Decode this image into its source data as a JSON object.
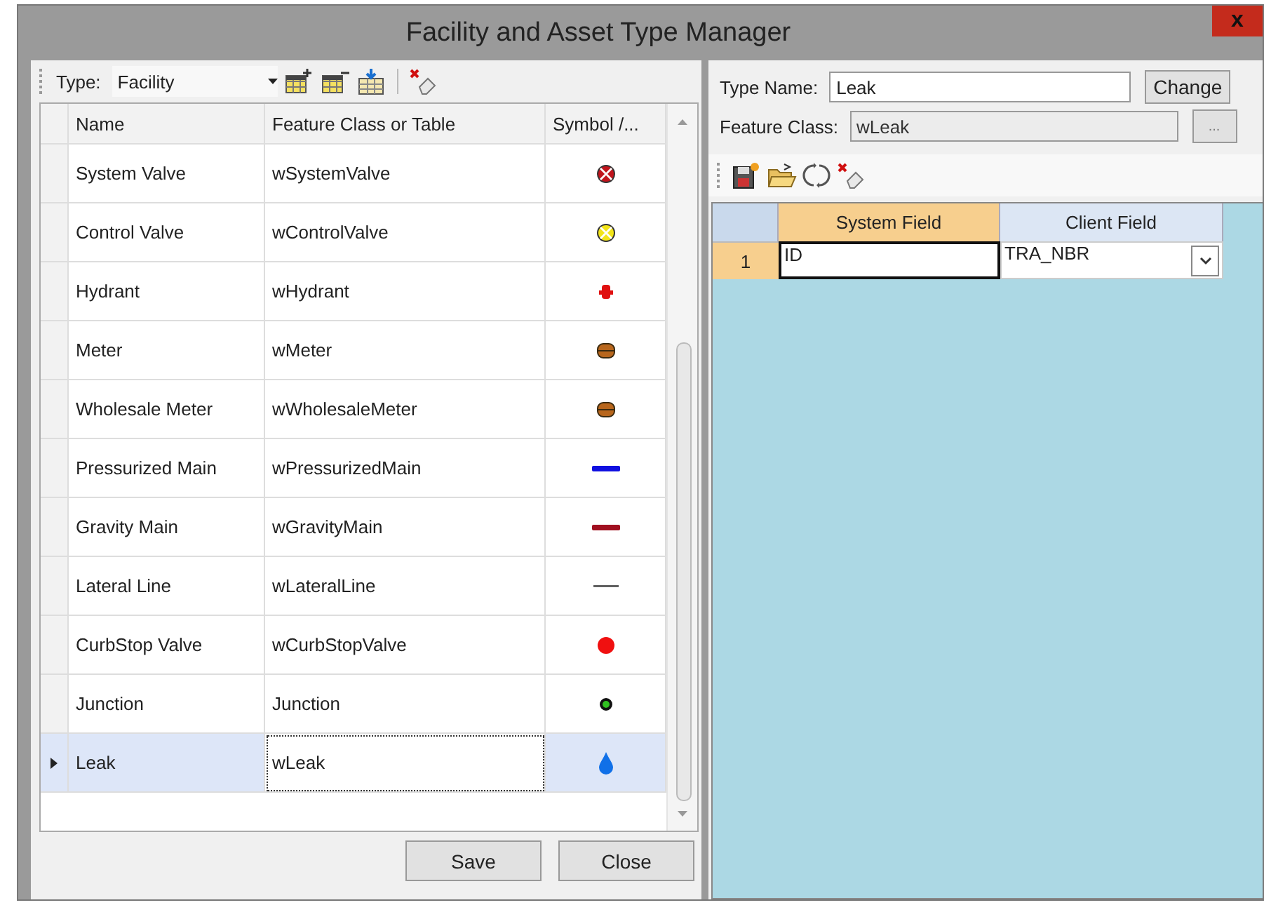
{
  "window": {
    "title": "Facility and Asset Type Manager",
    "close_label": "x"
  },
  "type_list": {
    "type_label": "Type:",
    "type_value": "Facility",
    "columns": [
      "Name",
      "Feature Class or Table",
      "Symbol /..."
    ],
    "rows": [
      {
        "name": "System Valve",
        "feature_class": "wSystemValve",
        "symbol": {
          "kind": "valve",
          "color": "#c0141c"
        },
        "selected": false
      },
      {
        "name": "Control Valve",
        "feature_class": "wControlValve",
        "symbol": {
          "kind": "valve",
          "color": "#f2e418"
        },
        "selected": false
      },
      {
        "name": "Hydrant",
        "feature_class": "wHydrant",
        "symbol": {
          "kind": "hydrant",
          "color": "#e01010"
        },
        "selected": false
      },
      {
        "name": "Meter",
        "feature_class": "wMeter",
        "symbol": {
          "kind": "meter",
          "color": "#b8661c"
        },
        "selected": false
      },
      {
        "name": "Wholesale Meter",
        "feature_class": "wWholesaleMeter",
        "symbol": {
          "kind": "meter",
          "color": "#b8661c"
        },
        "selected": false
      },
      {
        "name": "Pressurized Main",
        "feature_class": "wPressurizedMain",
        "symbol": {
          "kind": "line",
          "color": "#1010e0"
        },
        "selected": false
      },
      {
        "name": "Gravity Main",
        "feature_class": "wGravityMain",
        "symbol": {
          "kind": "line",
          "color": "#a01020"
        },
        "selected": false
      },
      {
        "name": "Lateral Line",
        "feature_class": "wLateralLine",
        "symbol": {
          "kind": "thin-line",
          "color": "#606060"
        },
        "selected": false
      },
      {
        "name": "CurbStop Valve",
        "feature_class": "wCurbStopValve",
        "symbol": {
          "kind": "dot",
          "color": "#f01010"
        },
        "selected": false
      },
      {
        "name": "Junction",
        "feature_class": "Junction",
        "symbol": {
          "kind": "ring-dot",
          "color": "#30c020"
        },
        "selected": false
      },
      {
        "name": "Leak",
        "feature_class": "wLeak",
        "symbol": {
          "kind": "drop",
          "color": "#1070e8"
        },
        "selected": true
      }
    ],
    "buttons": [
      "Save",
      "Close"
    ]
  },
  "type_detail": {
    "type_name_label": "Type Name:",
    "type_name": "Leak",
    "change_button": "Change",
    "feature_class_label": "Feature Class:",
    "feature_class": "wLeak",
    "browse_button": "...",
    "columns": [
      "System Field",
      "Client Field"
    ],
    "rows": [
      {
        "number": "1",
        "system_field": "ID",
        "client_field": "TRA_NBR",
        "selected": true
      }
    ]
  }
}
